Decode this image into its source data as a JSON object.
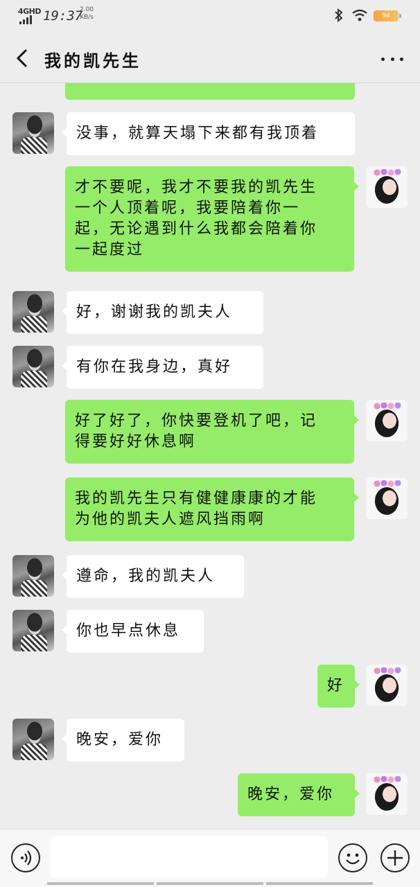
{
  "status_bar": {
    "network": "4GHD",
    "time": "19:37",
    "speed_value": "2.00",
    "speed_unit": "KB/s",
    "battery": "94",
    "icons": [
      "signal-icon",
      "bluetooth-icon",
      "wifi-icon",
      "battery-icon"
    ]
  },
  "nav": {
    "title": "我的凯先生",
    "back_icon": "chevron-left-icon",
    "more_icon": "more-dots-icon"
  },
  "colors": {
    "background": "#ededed",
    "sent_bubble": "#95ec69",
    "received_bubble": "#ffffff"
  },
  "messages": [
    {
      "sender": "other",
      "text": "没事，就算天塌下来都有我顶着"
    },
    {
      "sender": "me",
      "lines": [
        "才不要呢，我才不要我的凯先生",
        "一个人顶着呢，我要陪着你一",
        "起，无论遇到什么我都会陪着你",
        "一起度过"
      ]
    },
    {
      "sender": "other",
      "text": "好，谢谢我的凯夫人"
    },
    {
      "sender": "other",
      "text": "有你在我身边，真好"
    },
    {
      "sender": "me",
      "lines": [
        "好了好了，你快要登机了吧，记",
        "得要好好休息啊"
      ]
    },
    {
      "sender": "me",
      "lines": [
        "我的凯先生只有健健康康的才能",
        "为他的凯夫人遮风挡雨啊"
      ]
    },
    {
      "sender": "other",
      "text": "遵命，我的凯夫人"
    },
    {
      "sender": "other",
      "text": "你也早点休息"
    },
    {
      "sender": "me",
      "text": "好"
    },
    {
      "sender": "other",
      "text": "晚安，爱你"
    },
    {
      "sender": "me",
      "text": "晚安，爱你"
    }
  ],
  "input_bar": {
    "placeholder": "",
    "icons": [
      "voice-icon",
      "emoji-icon",
      "plus-icon"
    ]
  }
}
